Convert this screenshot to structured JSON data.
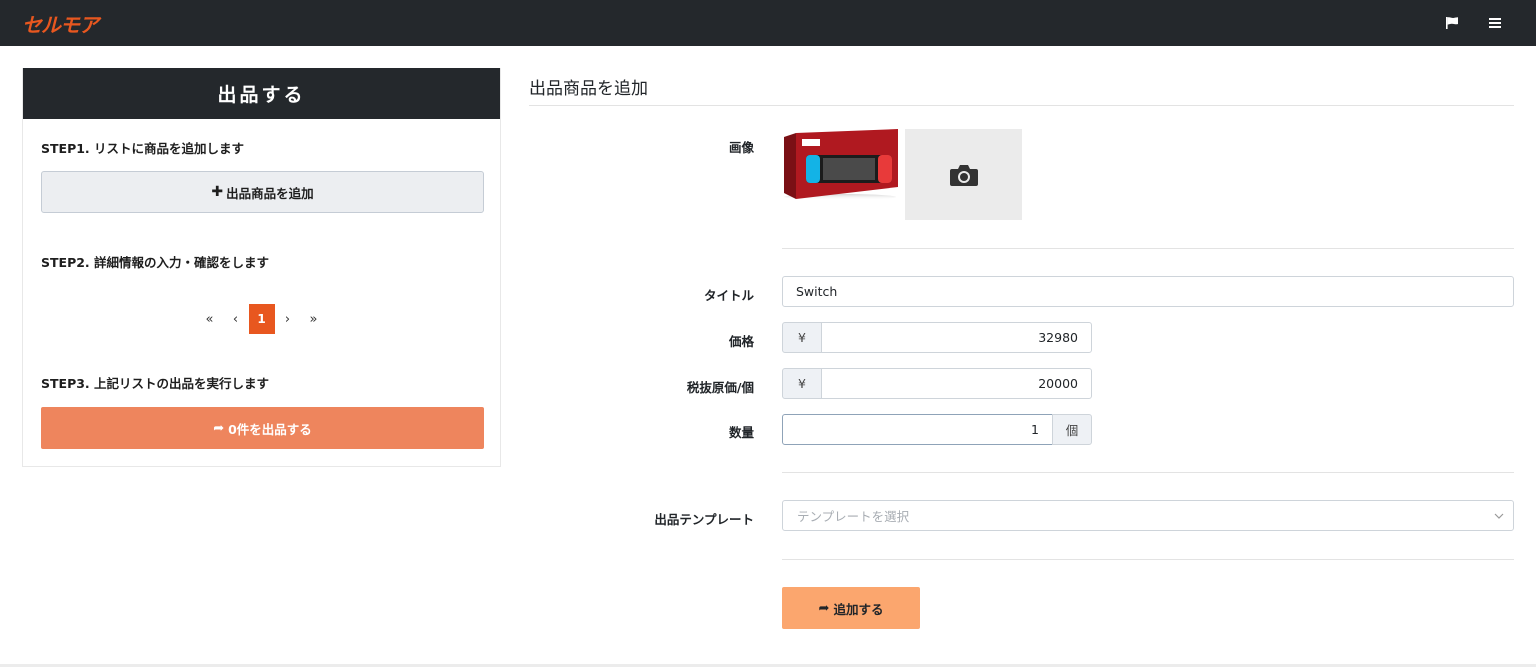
{
  "topbar": {
    "logo_text": "セルモア",
    "icons": [
      "flag-icon",
      "menu-icon"
    ]
  },
  "left": {
    "header": "出品する",
    "step1": "STEP1. リストに商品を追加します",
    "add_button": "出品商品を追加",
    "step2": "STEP2. 詳細情報の入力・確認をします",
    "pager": {
      "first": "«",
      "prev": "‹",
      "current": "1",
      "next": "›",
      "last": "»"
    },
    "step3": "STEP3. 上記リストの出品を実行します",
    "exec_button": "0件を出品する"
  },
  "form": {
    "title": "出品商品を追加",
    "image_label": "画像",
    "title_label": "タイトル",
    "title_value": "Switch",
    "price_label": "価格",
    "price_currency": "¥",
    "price_value": "32980",
    "cost_label": "税抜原価/個",
    "cost_currency": "¥",
    "cost_value": "20000",
    "qty_label": "数量",
    "qty_value": "1",
    "qty_unit": "個",
    "template_label": "出品テンプレート",
    "template_placeholder": "テンプレートを選択",
    "submit_button": "追加する"
  },
  "colors": {
    "accent": "#e8571f",
    "dark": "#24282c",
    "exec": "#ee855d",
    "submit": "#fba66e"
  }
}
